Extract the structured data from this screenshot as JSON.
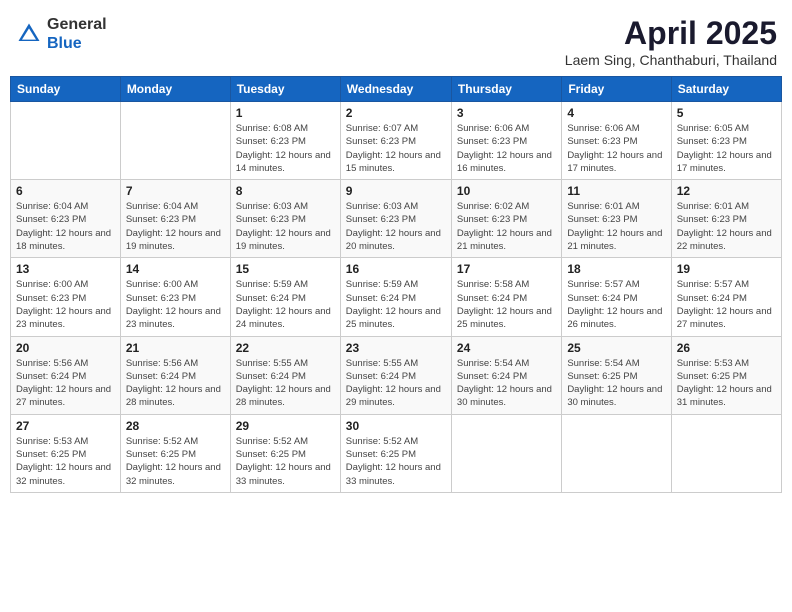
{
  "header": {
    "logo_general": "General",
    "logo_blue": "Blue",
    "month": "April 2025",
    "location": "Laem Sing, Chanthaburi, Thailand"
  },
  "weekdays": [
    "Sunday",
    "Monday",
    "Tuesday",
    "Wednesday",
    "Thursday",
    "Friday",
    "Saturday"
  ],
  "weeks": [
    [
      {
        "day": "",
        "info": ""
      },
      {
        "day": "",
        "info": ""
      },
      {
        "day": "1",
        "info": "Sunrise: 6:08 AM\nSunset: 6:23 PM\nDaylight: 12 hours and 14 minutes."
      },
      {
        "day": "2",
        "info": "Sunrise: 6:07 AM\nSunset: 6:23 PM\nDaylight: 12 hours and 15 minutes."
      },
      {
        "day": "3",
        "info": "Sunrise: 6:06 AM\nSunset: 6:23 PM\nDaylight: 12 hours and 16 minutes."
      },
      {
        "day": "4",
        "info": "Sunrise: 6:06 AM\nSunset: 6:23 PM\nDaylight: 12 hours and 17 minutes."
      },
      {
        "day": "5",
        "info": "Sunrise: 6:05 AM\nSunset: 6:23 PM\nDaylight: 12 hours and 17 minutes."
      }
    ],
    [
      {
        "day": "6",
        "info": "Sunrise: 6:04 AM\nSunset: 6:23 PM\nDaylight: 12 hours and 18 minutes."
      },
      {
        "day": "7",
        "info": "Sunrise: 6:04 AM\nSunset: 6:23 PM\nDaylight: 12 hours and 19 minutes."
      },
      {
        "day": "8",
        "info": "Sunrise: 6:03 AM\nSunset: 6:23 PM\nDaylight: 12 hours and 19 minutes."
      },
      {
        "day": "9",
        "info": "Sunrise: 6:03 AM\nSunset: 6:23 PM\nDaylight: 12 hours and 20 minutes."
      },
      {
        "day": "10",
        "info": "Sunrise: 6:02 AM\nSunset: 6:23 PM\nDaylight: 12 hours and 21 minutes."
      },
      {
        "day": "11",
        "info": "Sunrise: 6:01 AM\nSunset: 6:23 PM\nDaylight: 12 hours and 21 minutes."
      },
      {
        "day": "12",
        "info": "Sunrise: 6:01 AM\nSunset: 6:23 PM\nDaylight: 12 hours and 22 minutes."
      }
    ],
    [
      {
        "day": "13",
        "info": "Sunrise: 6:00 AM\nSunset: 6:23 PM\nDaylight: 12 hours and 23 minutes."
      },
      {
        "day": "14",
        "info": "Sunrise: 6:00 AM\nSunset: 6:23 PM\nDaylight: 12 hours and 23 minutes."
      },
      {
        "day": "15",
        "info": "Sunrise: 5:59 AM\nSunset: 6:24 PM\nDaylight: 12 hours and 24 minutes."
      },
      {
        "day": "16",
        "info": "Sunrise: 5:59 AM\nSunset: 6:24 PM\nDaylight: 12 hours and 25 minutes."
      },
      {
        "day": "17",
        "info": "Sunrise: 5:58 AM\nSunset: 6:24 PM\nDaylight: 12 hours and 25 minutes."
      },
      {
        "day": "18",
        "info": "Sunrise: 5:57 AM\nSunset: 6:24 PM\nDaylight: 12 hours and 26 minutes."
      },
      {
        "day": "19",
        "info": "Sunrise: 5:57 AM\nSunset: 6:24 PM\nDaylight: 12 hours and 27 minutes."
      }
    ],
    [
      {
        "day": "20",
        "info": "Sunrise: 5:56 AM\nSunset: 6:24 PM\nDaylight: 12 hours and 27 minutes."
      },
      {
        "day": "21",
        "info": "Sunrise: 5:56 AM\nSunset: 6:24 PM\nDaylight: 12 hours and 28 minutes."
      },
      {
        "day": "22",
        "info": "Sunrise: 5:55 AM\nSunset: 6:24 PM\nDaylight: 12 hours and 28 minutes."
      },
      {
        "day": "23",
        "info": "Sunrise: 5:55 AM\nSunset: 6:24 PM\nDaylight: 12 hours and 29 minutes."
      },
      {
        "day": "24",
        "info": "Sunrise: 5:54 AM\nSunset: 6:24 PM\nDaylight: 12 hours and 30 minutes."
      },
      {
        "day": "25",
        "info": "Sunrise: 5:54 AM\nSunset: 6:25 PM\nDaylight: 12 hours and 30 minutes."
      },
      {
        "day": "26",
        "info": "Sunrise: 5:53 AM\nSunset: 6:25 PM\nDaylight: 12 hours and 31 minutes."
      }
    ],
    [
      {
        "day": "27",
        "info": "Sunrise: 5:53 AM\nSunset: 6:25 PM\nDaylight: 12 hours and 32 minutes."
      },
      {
        "day": "28",
        "info": "Sunrise: 5:52 AM\nSunset: 6:25 PM\nDaylight: 12 hours and 32 minutes."
      },
      {
        "day": "29",
        "info": "Sunrise: 5:52 AM\nSunset: 6:25 PM\nDaylight: 12 hours and 33 minutes."
      },
      {
        "day": "30",
        "info": "Sunrise: 5:52 AM\nSunset: 6:25 PM\nDaylight: 12 hours and 33 minutes."
      },
      {
        "day": "",
        "info": ""
      },
      {
        "day": "",
        "info": ""
      },
      {
        "day": "",
        "info": ""
      }
    ]
  ]
}
